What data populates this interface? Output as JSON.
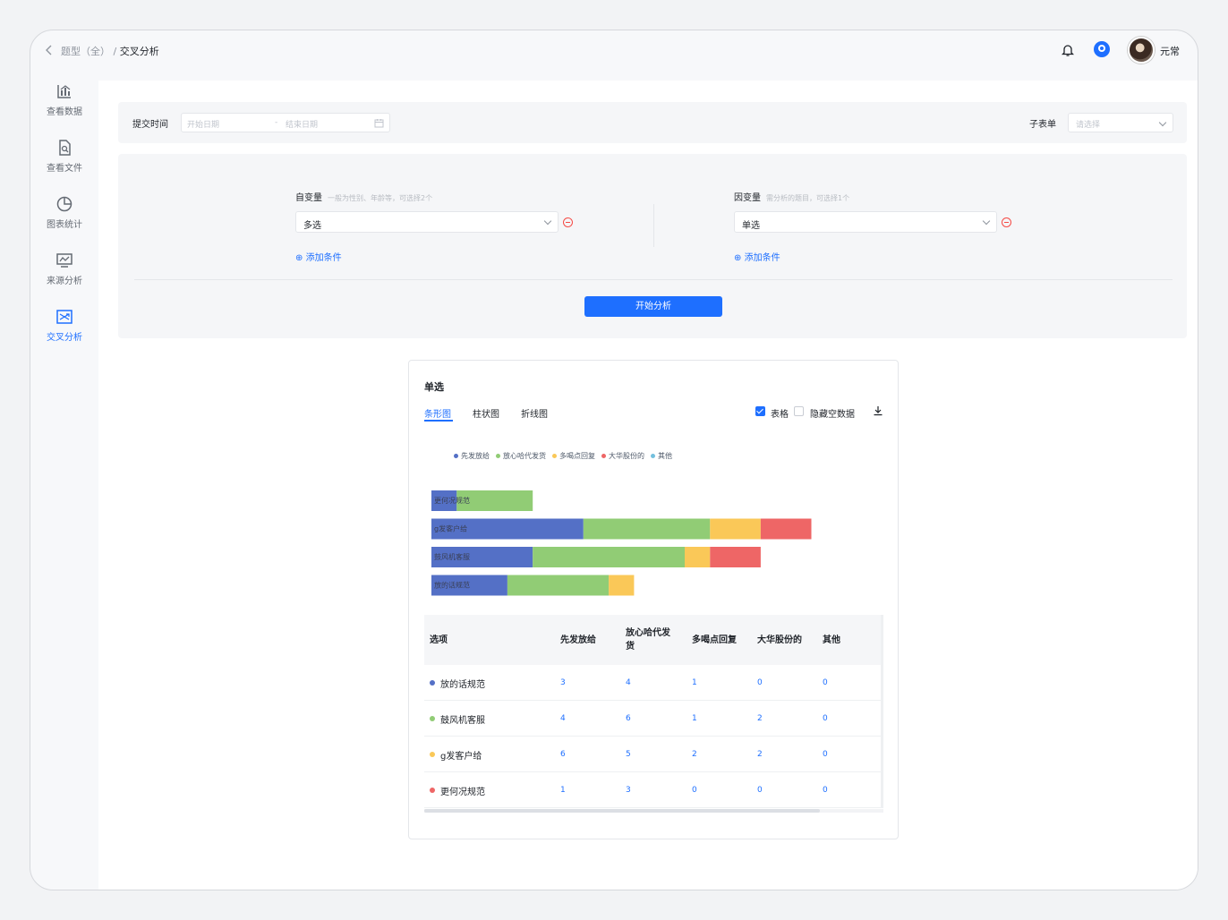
{
  "breadcrumb": {
    "parent": "题型（全）",
    "sep": "/",
    "current": "交叉分析"
  },
  "header": {
    "user_name": "元常"
  },
  "sidebar": {
    "items": [
      {
        "label": "查看数据",
        "icon": "bar-chart-icon"
      },
      {
        "label": "查看文件",
        "icon": "file-search-icon"
      },
      {
        "label": "图表统计",
        "icon": "pie-chart-icon"
      },
      {
        "label": "来源分析",
        "icon": "monitor-chart-icon"
      },
      {
        "label": "交叉分析",
        "icon": "cross-analysis-icon",
        "active": true
      }
    ]
  },
  "filters": {
    "submit_time_label": "提交时间",
    "start_placeholder": "开始日期",
    "range_sep": "-",
    "end_placeholder": "结束日期",
    "subform_label": "子表单",
    "subform_placeholder": "请选择"
  },
  "panel": {
    "independent": {
      "label": "自变量",
      "hint": "一般为性别、年龄等，可选择2个",
      "value": "多选",
      "add": "添加条件"
    },
    "dependent": {
      "label": "因变量",
      "hint": "需分析的题目，可选择1个",
      "value": "单选",
      "add": "添加条件"
    },
    "start_button": "开始分析"
  },
  "card": {
    "title": "单选",
    "tabs": [
      "条形图",
      "柱状图",
      "折线图"
    ],
    "active_tab": 0,
    "table_toggle": {
      "label": "表格",
      "checked": true
    },
    "hide_empty": {
      "label": "隐藏空数据",
      "checked": false
    }
  },
  "colors": {
    "blue": "#5470c6",
    "green": "#91cc75",
    "yellow": "#fac858",
    "red": "#ee6666",
    "cyan": "#73c0de",
    "accent": "#1e6fff"
  },
  "chart_data": {
    "type": "bar",
    "orientation": "horizontal",
    "stacked": true,
    "categories": [
      "更何况规范",
      "g发客户给",
      "鼓风机客服",
      "放的话规范"
    ],
    "series": [
      {
        "name": "先发放给",
        "color": "#5470c6",
        "values": [
          1,
          6,
          4,
          3
        ]
      },
      {
        "name": "放心哈代发货",
        "color": "#91cc75",
        "values": [
          3,
          5,
          6,
          4
        ]
      },
      {
        "name": "多喝点回复",
        "color": "#fac858",
        "values": [
          0,
          2,
          1,
          1
        ]
      },
      {
        "name": "大华股份的",
        "color": "#ee6666",
        "values": [
          0,
          2,
          2,
          0
        ]
      },
      {
        "name": "其他",
        "color": "#73c0de",
        "values": [
          0,
          0,
          0,
          0
        ]
      }
    ],
    "legend_position": "top-left",
    "grid": false
  },
  "table": {
    "headers": [
      "选项",
      "先发放给",
      "放心哈代发货",
      "多喝点回复",
      "大华股份的",
      "其他"
    ],
    "rows": [
      {
        "name": "放的话规范",
        "color": "#5470c6",
        "values": [
          "3",
          "4",
          "1",
          "0",
          "0"
        ]
      },
      {
        "name": "鼓风机客服",
        "color": "#91cc75",
        "values": [
          "4",
          "6",
          "1",
          "2",
          "0"
        ]
      },
      {
        "name": "g发客户给",
        "color": "#fac858",
        "values": [
          "6",
          "5",
          "2",
          "2",
          "0"
        ]
      },
      {
        "name": "更何况规范",
        "color": "#ee6666",
        "values": [
          "1",
          "3",
          "0",
          "0",
          "0"
        ]
      }
    ]
  }
}
